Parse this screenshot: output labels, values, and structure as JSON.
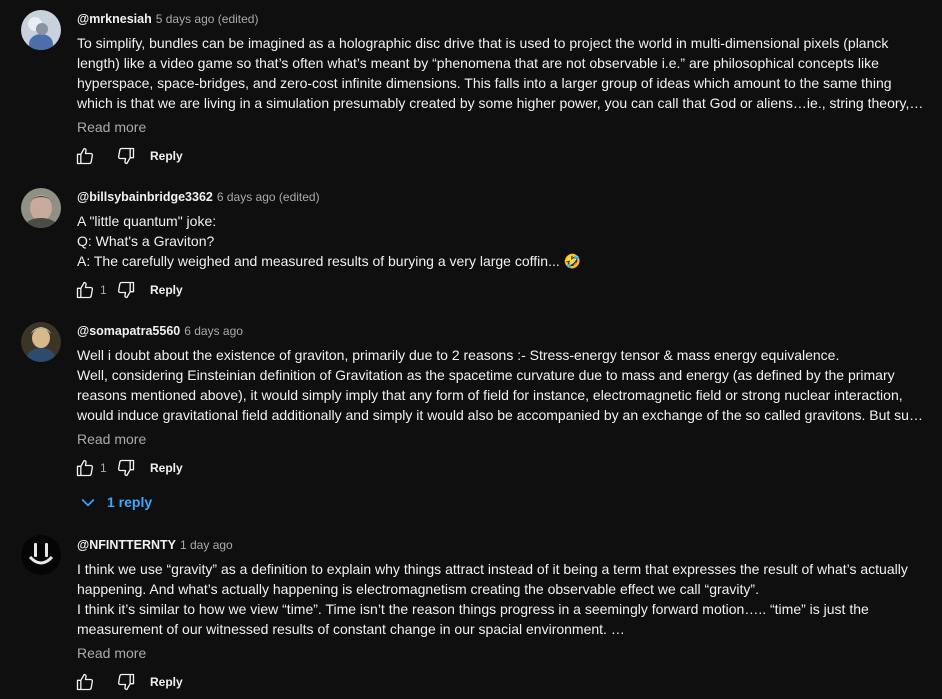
{
  "comments": [
    {
      "author": "@mrknesiah",
      "time": "5 days ago (edited)",
      "lines": [
        "To simplify, bundles can be imagined as a holographic disc drive that is used to project the world in multi-dimensional pixels  (planck",
        "length) like a video game so that’s often what’s meant by “phenomena that are not observable i.e.” are philosophical concepts like",
        "hyperspace, space-bridges, and zero-cost infinite dimensions.  This falls into a larger group of ideas which amount to the same thing",
        "which is that we are living in a simulation presumably created by some higher power, you can call that God or aliens…ie., string theory, …"
      ],
      "read_more": "Read more",
      "likes": "",
      "reply_label": "Reply"
    },
    {
      "author": "@billsybainbridge3362",
      "time": "6 days ago (edited)",
      "lines": [
        "A \"little quantum\" joke:",
        "Q: What's a Graviton?",
        "A: The carefully weighed and measured results of burying a very large coffin... 🤣"
      ],
      "likes": "1",
      "reply_label": "Reply"
    },
    {
      "author": "@somapatra5560",
      "time": "6 days ago",
      "lines": [
        "Well i doubt about the existence of graviton, primarily due to 2 reasons :- Stress-energy tensor & mass energy equivalence.",
        "Well, considering Einsteinian definition of Gravitation as the spacetime curvature due to mass and energy (as defined by the primary",
        "reasons mentioned above), it would simply imply that any form of field for instance, electromagnetic field or strong nuclear interaction,",
        "would induce gravitational field additionally and simply it would also be accompanied by an exchange of the so called gravitons. But such interactions"
      ],
      "read_more": "Read more",
      "likes": "1",
      "reply_label": "Reply",
      "replies": "1 reply"
    },
    {
      "author": "@NFINTTERNTY",
      "time": "1 day ago",
      "lines": [
        "I think we use “gravity” as a definition to explain why things attract instead of it being a term that expresses the result of what’s actually",
        "happening. And what’s actually happening is electromagnetism creating the observable effect we call “gravity”.",
        "I think it’s similar to how we view “time”. Time isn’t the reason things progress in a seemingly forward motion….. “time” is just the",
        "measurement of our witnessed results of constant change in our spacial environment. …"
      ],
      "read_more": "Read more",
      "likes": "",
      "reply_label": "Reply"
    }
  ]
}
